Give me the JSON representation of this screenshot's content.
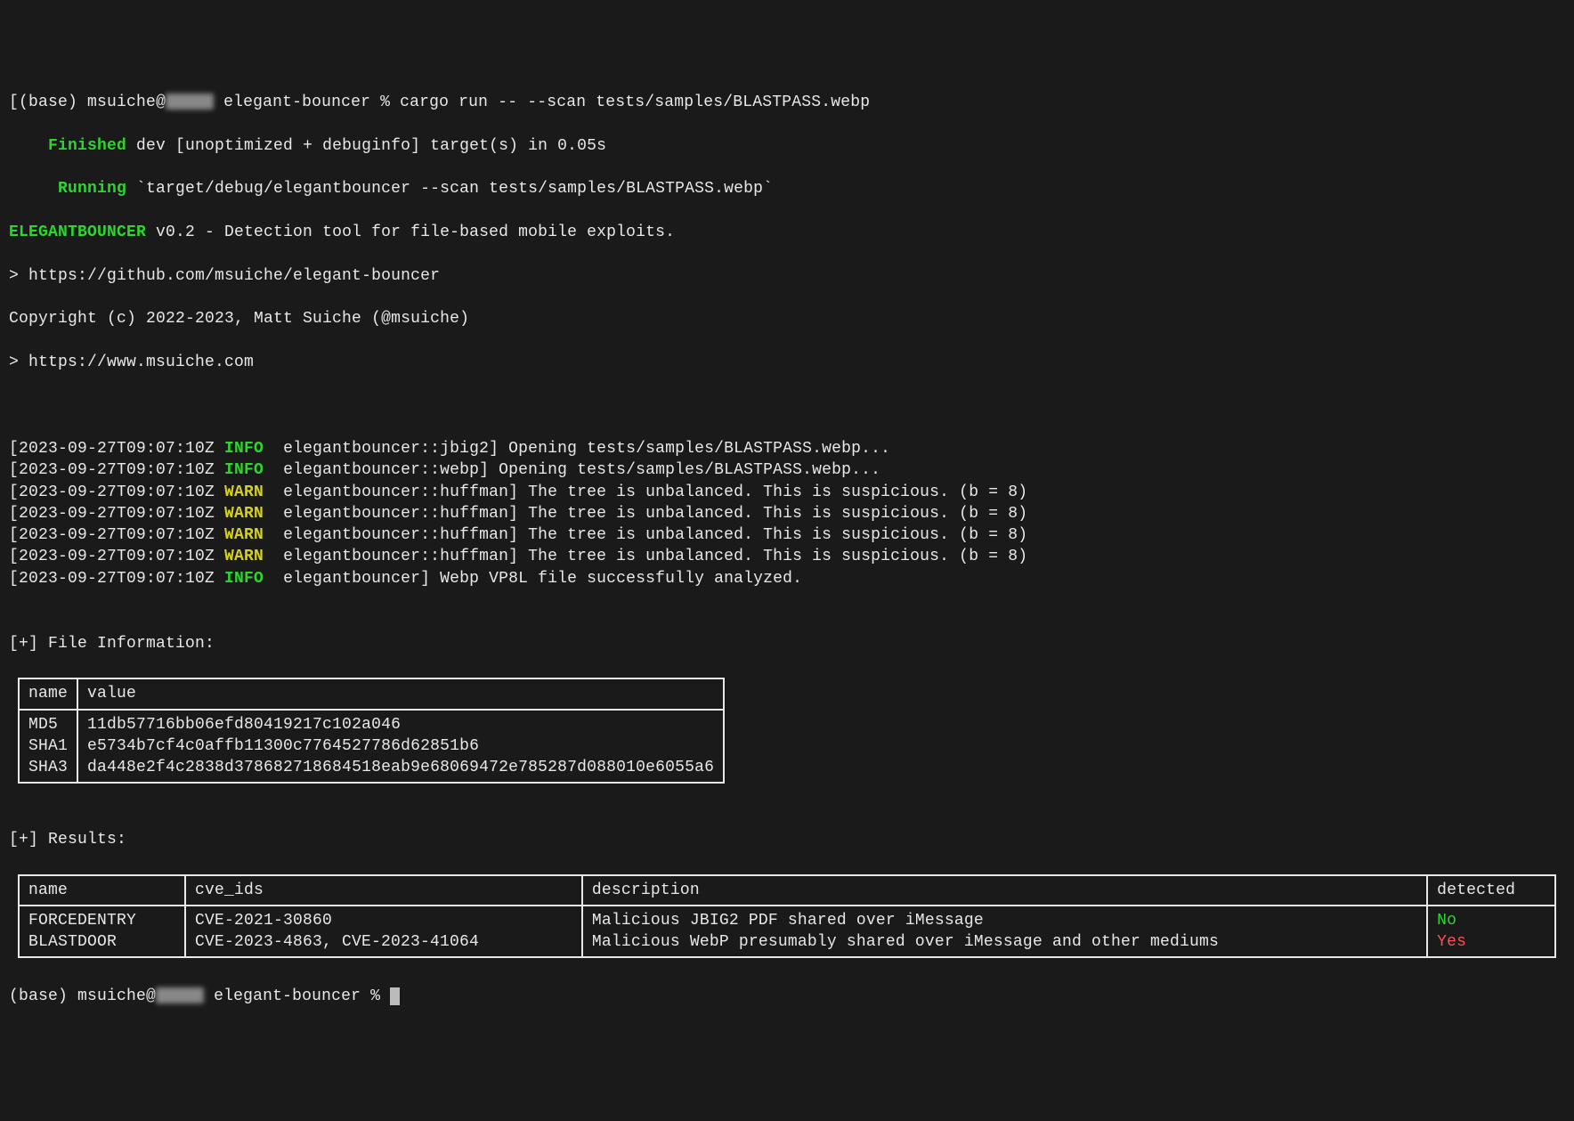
{
  "prompt": {
    "env": "(base)",
    "user": "msuiche",
    "at": "@",
    "dir": "elegant-bouncer",
    "symbol": "%",
    "command": "cargo run -- --scan tests/samples/BLASTPASS.webp"
  },
  "build": {
    "finished_label": "Finished",
    "finished_text": " dev [unoptimized + debuginfo] target(s) in 0.05s",
    "running_label": "Running",
    "running_text": " `target/debug/elegantbouncer --scan tests/samples/BLASTPASS.webp`"
  },
  "header": {
    "title_prefix": "ELEGANTBOUNCER",
    "title_rest": " v0.2 - Detection tool for file-based mobile exploits.",
    "url1": "> https://github.com/msuiche/elegant-bouncer",
    "copyright": "Copyright (c) 2022-2023, Matt Suiche (@msuiche)",
    "url2": "> https://www.msuiche.com"
  },
  "logs": [
    {
      "ts": "[2023-09-27T09:07:10Z ",
      "level": "INFO",
      "level_class": "green",
      "rest": "  elegantbouncer::jbig2] Opening tests/samples/BLASTPASS.webp..."
    },
    {
      "ts": "[2023-09-27T09:07:10Z ",
      "level": "INFO",
      "level_class": "green",
      "rest": "  elegantbouncer::webp] Opening tests/samples/BLASTPASS.webp..."
    },
    {
      "ts": "[2023-09-27T09:07:10Z ",
      "level": "WARN",
      "level_class": "yellow",
      "rest": "  elegantbouncer::huffman] The tree is unbalanced. This is suspicious. (b = 8)"
    },
    {
      "ts": "[2023-09-27T09:07:10Z ",
      "level": "WARN",
      "level_class": "yellow",
      "rest": "  elegantbouncer::huffman] The tree is unbalanced. This is suspicious. (b = 8)"
    },
    {
      "ts": "[2023-09-27T09:07:10Z ",
      "level": "WARN",
      "level_class": "yellow",
      "rest": "  elegantbouncer::huffman] The tree is unbalanced. This is suspicious. (b = 8)"
    },
    {
      "ts": "[2023-09-27T09:07:10Z ",
      "level": "WARN",
      "level_class": "yellow",
      "rest": "  elegantbouncer::huffman] The tree is unbalanced. This is suspicious. (b = 8)"
    },
    {
      "ts": "[2023-09-27T09:07:10Z ",
      "level": "INFO",
      "level_class": "green",
      "rest": "  elegantbouncer] Webp VP8L file successfully analyzed."
    }
  ],
  "file_info": {
    "section_title": "[+] File Information:",
    "headers": [
      "name",
      "value"
    ],
    "rows": [
      {
        "name": "MD5",
        "value": "11db57716bb06efd80419217c102a046"
      },
      {
        "name": "SHA1",
        "value": "e5734b7cf4c0affb11300c7764527786d62851b6"
      },
      {
        "name": "SHA3",
        "value": "da448e2f4c2838d378682718684518eab9e68069472e785287d088010e6055a6"
      }
    ]
  },
  "results": {
    "section_title": "[+] Results:",
    "headers": [
      "name",
      "cve_ids",
      "description",
      "detected"
    ],
    "rows": [
      {
        "name": "FORCEDENTRY",
        "cve_ids": "CVE-2021-30860",
        "description": "Malicious JBIG2 PDF shared over iMessage",
        "detected": "No",
        "detected_class": "green-plain"
      },
      {
        "name": "BLASTDOOR",
        "cve_ids": "CVE-2023-4863, CVE-2023-41064",
        "description": "Malicious WebP presumably shared over iMessage and other mediums",
        "detected": "Yes",
        "detected_class": "red"
      }
    ]
  },
  "prompt2": {
    "env": "(base)",
    "user": "msuiche",
    "at": "@",
    "dir": "elegant-bouncer",
    "symbol": "%"
  }
}
